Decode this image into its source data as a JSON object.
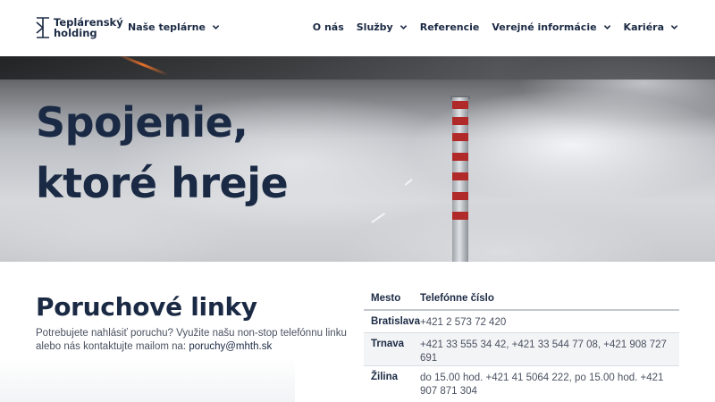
{
  "header": {
    "logo": {
      "line1": "Teplárenský",
      "line2": "holding",
      "icon": "teplarensky-holding-logo-icon"
    },
    "nav_left": {
      "label": "Naše teplárne",
      "icon": "chevron-down-icon"
    },
    "nav_right": [
      {
        "label": "O nás",
        "has_dropdown": false
      },
      {
        "label": "Služby",
        "has_dropdown": true
      },
      {
        "label": "Referencie",
        "has_dropdown": false
      },
      {
        "label": "Verejné informácie",
        "has_dropdown": true
      },
      {
        "label": "Kariéra",
        "has_dropdown": true
      }
    ]
  },
  "hero": {
    "title_line1": "Spojenie,",
    "title_line2": "ktoré hreje"
  },
  "faults": {
    "title": "Poruchové linky",
    "description": "Potrebujete nahlásiť poruchu? Využite našu non-stop telefónnu linku alebo nás kontaktujte mailom na:",
    "email": "poruchy@mhth.sk",
    "table": {
      "headers": {
        "city": "Mesto",
        "phone": "Telefónne číslo"
      },
      "rows": [
        {
          "city": "Bratislava",
          "phone": "+421 2 573 72 420"
        },
        {
          "city": "Trnava",
          "phone": "+421 33 555 34 42, +421 33 544 77 08, +421 908 727 691"
        },
        {
          "city": "Žilina",
          "phone": "do 15.00 hod. +421 41 5064 222, po 15.00 hod. +421 907 871 304"
        }
      ]
    }
  },
  "colors": {
    "brand_navy": "#1b2a44",
    "chimney_red": "#b02a2a",
    "table_alt_row": "#f3f4f6"
  }
}
